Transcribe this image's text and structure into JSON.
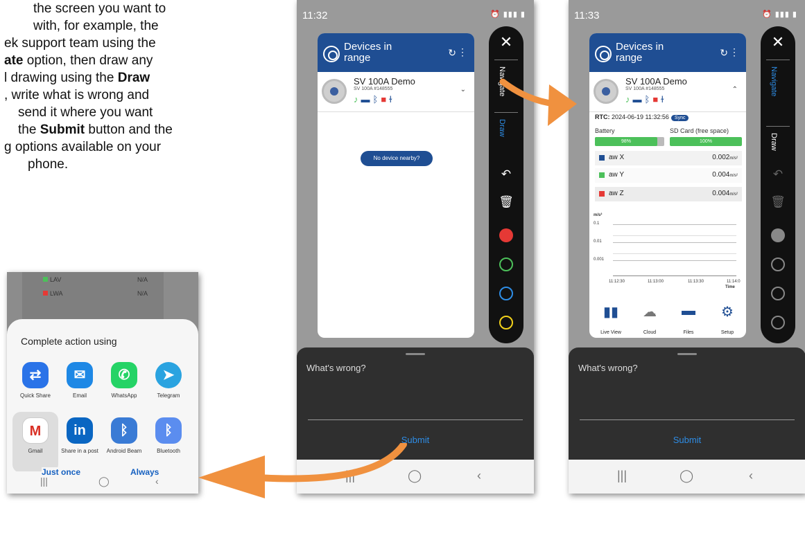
{
  "instructions": {
    "l1": "the screen you want to",
    "l2": "with, for example, the",
    "l3": "ek support team using the",
    "l4a": "ate",
    "l4b": " option, then draw any",
    "l5a": "l drawing using the ",
    "l5b": "Draw",
    "l6": ", write what is wrong and",
    "l7": "send it where you want",
    "l8a": "the ",
    "l8b": "Submit",
    "l8c": " button and the",
    "l9": "g options available on your",
    "l10": "phone."
  },
  "phone2": {
    "time": "11:32",
    "app_title_1": "Devices in",
    "app_title_2": "range",
    "device_name": "SV 100A Demo",
    "device_serial": "SV 100A #148555",
    "no_device_button": "No device nearby?",
    "side_navigate": "Navigate",
    "side_draw": "Draw",
    "whats_wrong": "What's wrong?",
    "submit": "Submit",
    "active_side": "Draw",
    "selected_color": "#e53935"
  },
  "phone3": {
    "time": "11:33",
    "app_title_1": "Devices in",
    "app_title_2": "range",
    "device_name": "SV 100A Demo",
    "device_serial": "SV 100A #148555",
    "rtc_label": "RTC:",
    "rtc_value": "2024-06-19 11:32:56",
    "sync": "Sync",
    "battery_label": "Battery",
    "sd_label": "SD Card (free space)",
    "battery_pct": "98%",
    "sd_pct": "100%",
    "rows": [
      {
        "name": "aw X",
        "value": "0.002",
        "unit": "m/s²",
        "color": "#1f4e93"
      },
      {
        "name": "aw Y",
        "value": "0.004",
        "unit": "m/s²",
        "color": "#4cc05a"
      },
      {
        "name": "aw Z",
        "value": "0.004",
        "unit": "m/s²",
        "color": "#e53935"
      }
    ],
    "chart_unit": "m/s²",
    "y_ticks": [
      "0.1",
      "0.01",
      "0.001"
    ],
    "x_ticks": [
      "11:12:30",
      "11:13:00",
      "11:13:30",
      "11:14:0"
    ],
    "x_title": "Time",
    "nav": [
      "Live View",
      "Cloud",
      "Files",
      "Setup"
    ],
    "side_navigate": "Navigate",
    "side_draw": "Draw",
    "whats_wrong": "What's wrong?",
    "submit": "Submit",
    "active_side": "Navigate"
  },
  "share": {
    "bg_rows": [
      {
        "name": "LAV",
        "value": "N/A"
      },
      {
        "name": "LWA",
        "value": "N/A"
      }
    ],
    "title": "Complete action using",
    "apps": [
      {
        "label": "Quick Share",
        "color": "#2a73e8"
      },
      {
        "label": "Email",
        "color": "#1e88e5"
      },
      {
        "label": "WhatsApp",
        "color": "#25d366"
      },
      {
        "label": "Telegram",
        "color": "#2aa3e0"
      },
      {
        "label": "Gmail",
        "color": "#ffffff"
      },
      {
        "label": "Share in a post",
        "color": "#0a66c2"
      },
      {
        "label": "Android Beam",
        "color": "#3a7bd5"
      },
      {
        "label": "Bluetooth",
        "color": "#5b8def"
      }
    ],
    "just_once": "Just once",
    "always": "Always"
  },
  "colors": {
    "accent": "#1f4e93",
    "arrow": "#f0913f",
    "submit": "#2e8de6"
  }
}
